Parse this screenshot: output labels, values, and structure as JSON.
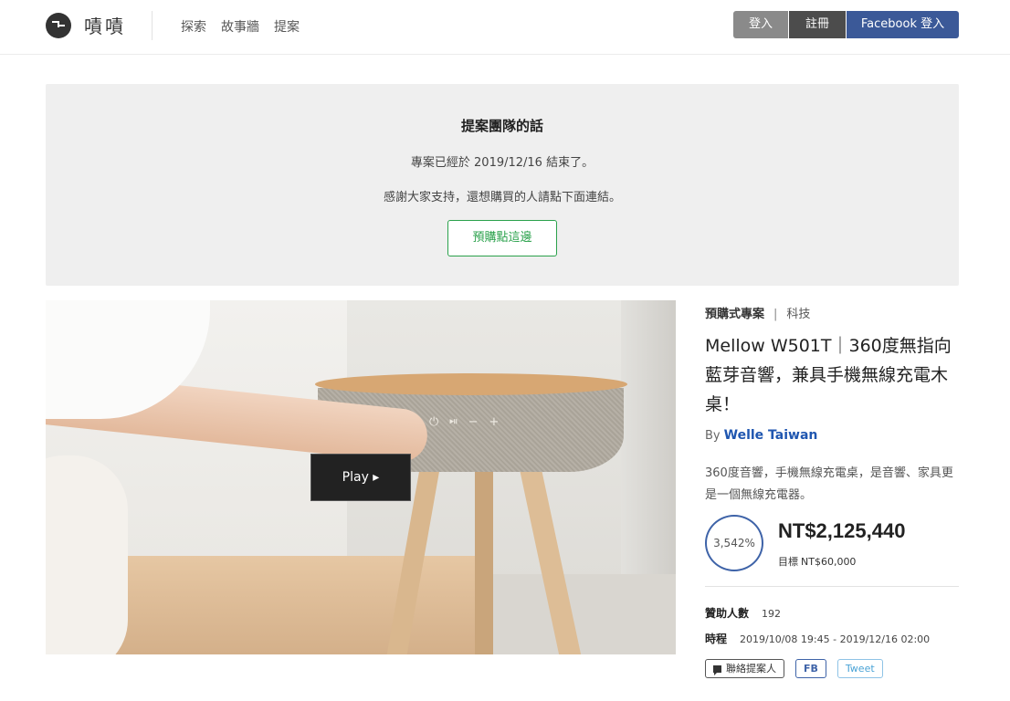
{
  "header": {
    "logo_text": "嘖嘖",
    "nav": [
      "探索",
      "故事牆",
      "提案"
    ],
    "login_label": "登入",
    "register_label": "註冊",
    "facebook_login_label": "Facebook 登入"
  },
  "notice": {
    "title": "提案團隊的話",
    "line1": "專案已經於 2019/12/16 結束了。",
    "line2": "感謝大家支持，還想購買的人請點下面連結。",
    "button_label": "預購點這邊"
  },
  "media": {
    "play_label": "Play ▸",
    "controls_glyphs": "⏻⏯−+"
  },
  "project": {
    "type": "預購式專案",
    "separator": "|",
    "category": "科技",
    "title": "Mellow W501T｜360度無指向藍芽音響，兼具手機無線充電木桌！",
    "by_label": "By",
    "author": "Welle Taiwan",
    "description": "360度音響，手機無線充電桌，是音響、家具更是一個無線充電器。",
    "percent": "3,542%",
    "amount": "NT$2,125,440",
    "goal_label": "目標",
    "goal_value": "NT$60,000",
    "backers_label": "贊助人數",
    "backers_value": "192",
    "period_label": "時程",
    "period_value": "2019/10/08 19:45 - 2019/12/16 02:00",
    "contact_label": "聯絡提案人",
    "fb_label": "FB",
    "tweet_label": "Tweet"
  },
  "colors": {
    "facebook": "#3b5998",
    "accent_green": "#2aa14b",
    "author_blue": "#1f56b0",
    "progress_ring": "#3e63a8"
  }
}
